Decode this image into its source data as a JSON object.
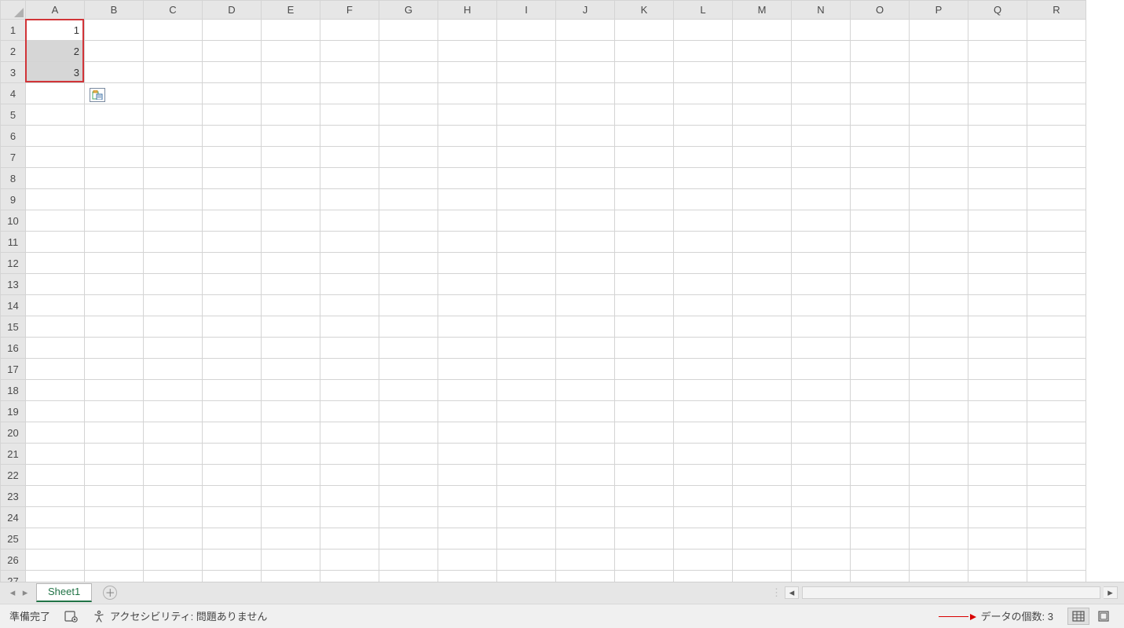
{
  "grid": {
    "columns": [
      "A",
      "B",
      "C",
      "D",
      "E",
      "F",
      "G",
      "H",
      "I",
      "J",
      "K",
      "L",
      "M",
      "N",
      "O",
      "P",
      "Q",
      "R"
    ],
    "rows": [
      "1",
      "2",
      "3",
      "4",
      "5",
      "6",
      "7",
      "8",
      "9",
      "10",
      "11",
      "12",
      "13",
      "14",
      "15",
      "16",
      "17",
      "18",
      "19",
      "20",
      "21",
      "22",
      "23",
      "24",
      "25",
      "26",
      "27"
    ],
    "cells": {
      "A1": "1",
      "A2": "2",
      "A3": "3"
    },
    "selection": {
      "from": "A1",
      "to": "A3",
      "active": "A1"
    },
    "smarttag_icon_name": "paste-options-icon"
  },
  "tabstrip": {
    "prev_icon": "◂",
    "next_icon": "▸",
    "sheet_tab_label": "Sheet1",
    "add_tab_label": "＋",
    "grip": "⋮"
  },
  "statusbar": {
    "ready_label": "準備完了",
    "macro_icon_name": "macro-record-icon",
    "accessibility_label": "アクセシビリティ: 問題ありません",
    "count_label": "データの個数: 3",
    "view_normal_icon": "normal-view-icon",
    "view_pagelayout_icon": "page-layout-view-icon"
  },
  "colors": {
    "selection_border": "#d13438",
    "tab_accent": "#217346"
  }
}
